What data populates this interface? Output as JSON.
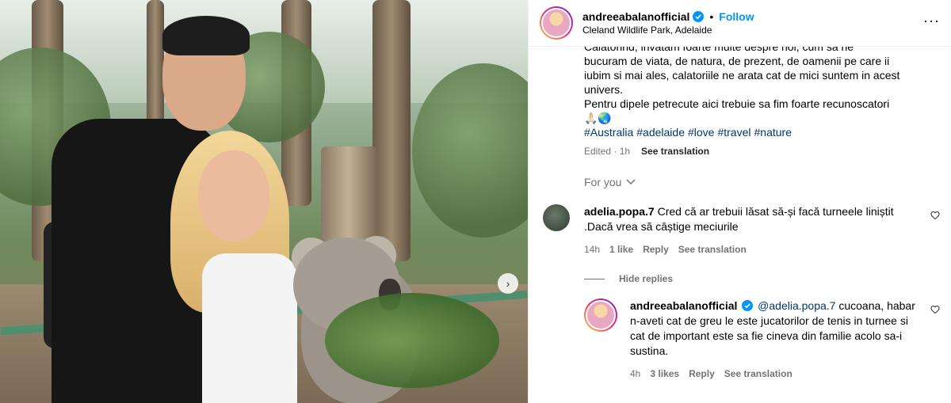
{
  "post": {
    "username": "andreeabalanofficial",
    "follow_label": "Follow",
    "location": "Cleland Wildlife Park, Adelaide",
    "more_icon": "more-horizontal-icon"
  },
  "caption": {
    "partial_line": "Calatorind, invatam foarte multe despre noi, cum sa ne",
    "line1": "bucuram de viata, de natura, de prezent, de oamenii pe care ii",
    "line2": "iubim si mai ales, calatoriile ne arata cat de mici suntem in acest",
    "line3": "univers.",
    "line4": "Pentru dipele petrecute aici trebuie sa fim foarte recunoscatori",
    "emojis": "🙏🏻🌏",
    "hashtags": [
      "#Australia",
      "#adelaide",
      "#love",
      "#travel",
      "#nature"
    ],
    "edited": "Edited · 1h",
    "see_translation": "See translation"
  },
  "for_you": "For you",
  "comment": {
    "username": "adelia.popa.7",
    "text": "Cred că ar trebuii lăsat să-și facă turneele liniștit .Dacă vrea să câștige meciurile",
    "time": "14h",
    "likes": "1 like",
    "reply": "Reply",
    "see_translation": "See translation"
  },
  "hide_replies": "Hide replies",
  "reply": {
    "username": "andreeabalanofficial",
    "mention": "@adelia.popa.7",
    "text": "cucoana, habar n-aveti cat de greu le este jucatorilor de tenis in turnee si cat de important este sa fie cineva din familie acolo sa-i sustina.",
    "time": "4h",
    "likes": "3 likes",
    "reply": "Reply",
    "see_translation": "See translation"
  },
  "colors": {
    "accent": "#0095f6",
    "hashtag": "#00376b",
    "muted": "#737373"
  }
}
